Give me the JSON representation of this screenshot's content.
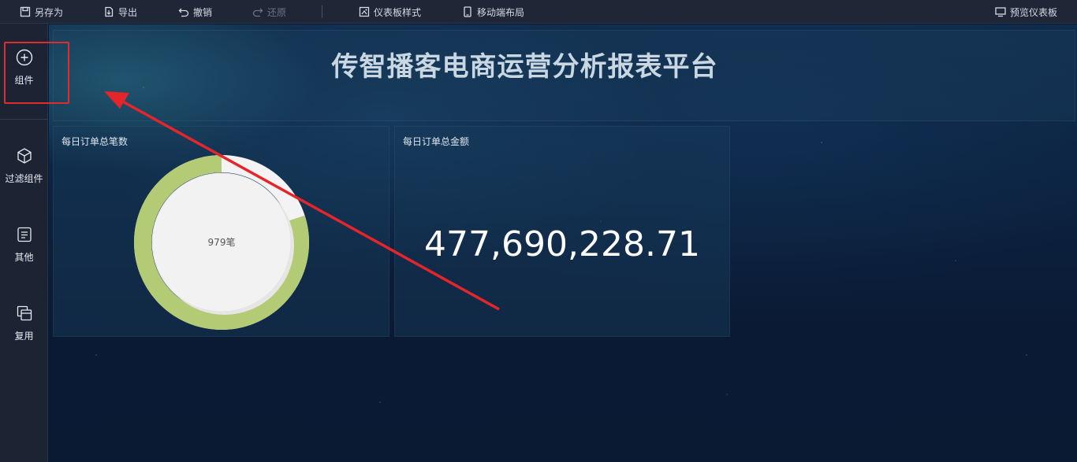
{
  "toolbar": {
    "save_as": "另存为",
    "export": "导出",
    "undo": "撤销",
    "redo": "还原",
    "dashboard_style": "仪表板样式",
    "mobile_layout": "移动端布局",
    "preview": "预览仪表板"
  },
  "sidebar": {
    "items": [
      {
        "label": "组件",
        "icon": "plus-circle-icon"
      },
      {
        "label": "过滤组件",
        "icon": "cube-icon"
      },
      {
        "label": "其他",
        "icon": "document-icon"
      },
      {
        "label": "复用",
        "icon": "copy-icon"
      }
    ]
  },
  "dashboard": {
    "title": "传智播客电商运营分析报表平台",
    "cards": [
      {
        "title": "每日订单总笔数",
        "value_label": "979笔",
        "progress": 0.8
      },
      {
        "title": "每日订单总金额",
        "value": "477,690,228.71"
      }
    ]
  },
  "colors": {
    "progress": "#b3cb74",
    "track": "#f3f3f3",
    "highlight": "#e02c2c"
  }
}
